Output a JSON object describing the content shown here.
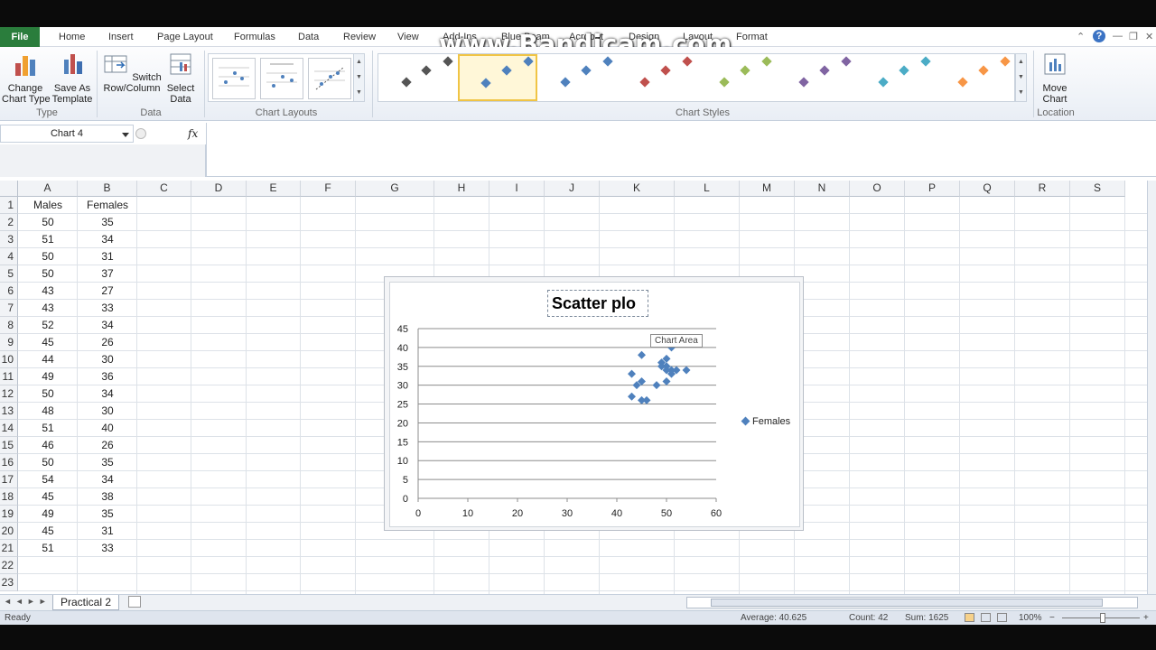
{
  "tabs": {
    "file": "File",
    "items": [
      "Home",
      "Insert",
      "Page Layout",
      "Formulas",
      "Data",
      "Review",
      "View",
      "Add-Ins",
      "Blue Beam",
      "Acrobat",
      "Design",
      "Layout",
      "Format"
    ]
  },
  "watermark": "www.Bandicam.com",
  "ribbon": {
    "change_chart_type": "Change\nChart Type",
    "save_as_template": "Save As\nTemplate",
    "group_type": "Type",
    "switch_row_column": "Switch\nRow/Column",
    "select_data": "Select\nData",
    "group_data": "Data",
    "group_chart_layouts": "Chart Layouts",
    "group_chart_styles": "Chart Styles",
    "move_chart": "Move\nChart",
    "group_location": "Location",
    "style_colors": [
      "#555555",
      "#4f81bd",
      "#4f81bd",
      "#c0504d",
      "#9bbb59",
      "#8064a2",
      "#4bacc6",
      "#f79646"
    ]
  },
  "formula_bar": {
    "name_box": "Chart 4",
    "fx": "fx",
    "value": ""
  },
  "columns": [
    "A",
    "B",
    "C",
    "D",
    "E",
    "F",
    "G",
    "H",
    "I",
    "J",
    "K",
    "L",
    "M",
    "N",
    "O",
    "P",
    "Q",
    "R",
    "S"
  ],
  "rows": [
    "1",
    "2",
    "3",
    "4",
    "5",
    "6",
    "7",
    "8",
    "9",
    "10",
    "11",
    "12",
    "13",
    "14",
    "15",
    "16",
    "17",
    "18",
    "19",
    "20",
    "21",
    "22",
    "23"
  ],
  "sheet": {
    "header": [
      "Males",
      "Females"
    ],
    "data": [
      [
        "50",
        "35"
      ],
      [
        "51",
        "34"
      ],
      [
        "50",
        "31"
      ],
      [
        "50",
        "37"
      ],
      [
        "43",
        "27"
      ],
      [
        "43",
        "33"
      ],
      [
        "52",
        "34"
      ],
      [
        "45",
        "26"
      ],
      [
        "44",
        "30"
      ],
      [
        "49",
        "36"
      ],
      [
        "50",
        "34"
      ],
      [
        "48",
        "30"
      ],
      [
        "51",
        "40"
      ],
      [
        "46",
        "26"
      ],
      [
        "50",
        "35"
      ],
      [
        "54",
        "34"
      ],
      [
        "45",
        "38"
      ],
      [
        "49",
        "35"
      ],
      [
        "45",
        "31"
      ],
      [
        "51",
        "33"
      ]
    ]
  },
  "chart_data": {
    "type": "scatter",
    "title": "Scatter  plo",
    "series": [
      {
        "name": "Females",
        "color": "#4f81bd",
        "x": [
          50,
          51,
          50,
          50,
          43,
          43,
          52,
          45,
          44,
          49,
          50,
          48,
          51,
          46,
          50,
          54,
          45,
          49,
          45,
          51
        ],
        "y": [
          35,
          34,
          31,
          37,
          27,
          33,
          34,
          26,
          30,
          36,
          34,
          30,
          40,
          26,
          35,
          34,
          38,
          35,
          31,
          33
        ]
      }
    ],
    "xlim": [
      0,
      60
    ],
    "ylim": [
      0,
      45
    ],
    "x_ticks": [
      "0",
      "10",
      "20",
      "30",
      "40",
      "50",
      "60"
    ],
    "y_ticks": [
      "0",
      "5",
      "10",
      "15",
      "20",
      "25",
      "30",
      "35",
      "40",
      "45"
    ],
    "grid": "horizontal",
    "legend": "right",
    "tooltip": "Chart Area"
  },
  "sheet_tab": "Practical 2",
  "status": {
    "ready": "Ready",
    "average": "Average: 40.625",
    "count": "Count: 42",
    "sum": "Sum: 1625",
    "zoom": "100%"
  }
}
